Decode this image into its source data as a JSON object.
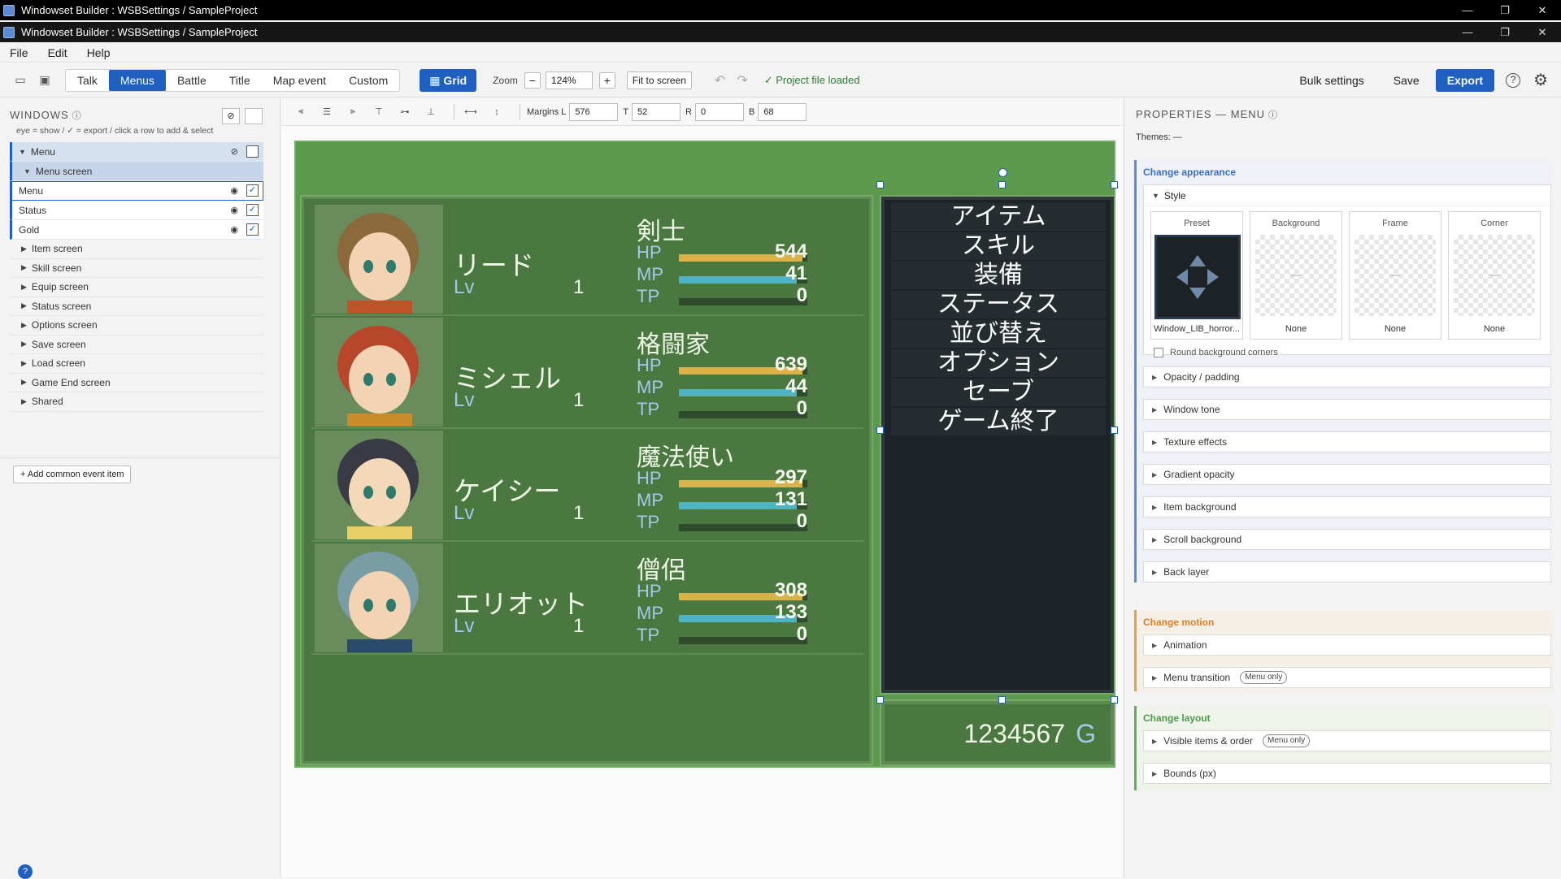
{
  "window_title": "Windowset Builder : WSBSettings / SampleProject",
  "window_controls": [
    "—",
    "❐",
    "✕"
  ],
  "menubar": [
    "File",
    "Edit",
    "Help"
  ],
  "toolbar": {
    "tabs": [
      "Talk",
      "Menus",
      "Battle",
      "Title",
      "Map event",
      "Custom"
    ],
    "active_tab": "Menus",
    "grid_label": "Grid",
    "zoom_label": "Zoom",
    "zoom_value": "124%",
    "fit_label": "Fit to screen",
    "status": "✓ Project file loaded",
    "bulk_label": "Bulk settings",
    "save_label": "Save",
    "export_label": "Export"
  },
  "left": {
    "title": "WINDOWS",
    "hint": "eye = show / ✓ = export / click a row to add & select",
    "menu_label": "Menu",
    "screen_label": "Menu screen",
    "items": [
      "Menu",
      "Status",
      "Gold"
    ],
    "screens": [
      "Item screen",
      "Skill screen",
      "Equip screen",
      "Status screen",
      "Options screen",
      "Save screen",
      "Load screen",
      "Game End screen",
      "Shared"
    ],
    "add_label": "+ Add common event item"
  },
  "align": {
    "margins_label": "Margins",
    "L": "576",
    "T": "52",
    "R": "0",
    "B": "68"
  },
  "game": {
    "actors": [
      {
        "name": "リード",
        "class": "剣士",
        "lv_label": "Lv",
        "lv": "1",
        "hp": "544",
        "mp": "41",
        "tp": "0",
        "hp_frac": 0.96,
        "mp_frac": 0.92,
        "tp_frac": 0
      },
      {
        "name": "ミシェル",
        "class": "格闘家",
        "lv_label": "Lv",
        "lv": "1",
        "hp": "639",
        "mp": "44",
        "tp": "0",
        "hp_frac": 0.96,
        "mp_frac": 0.92,
        "tp_frac": 0
      },
      {
        "name": "ケイシー",
        "class": "魔法使い",
        "lv_label": "Lv",
        "lv": "1",
        "hp": "297",
        "mp": "131",
        "tp": "0",
        "hp_frac": 0.96,
        "mp_frac": 0.92,
        "tp_frac": 0
      },
      {
        "name": "エリオット",
        "class": "僧侶",
        "lv_label": "Lv",
        "lv": "1",
        "hp": "308",
        "mp": "133",
        "tp": "0",
        "hp_frac": 0.96,
        "mp_frac": 0.92,
        "tp_frac": 0
      }
    ],
    "gauge_labels": {
      "hp": "HP",
      "mp": "MP",
      "tp": "TP"
    },
    "commands": [
      "アイテム",
      "スキル",
      "装備",
      "ステータス",
      "並び替え",
      "オプション",
      "セーブ",
      "ゲーム終了"
    ],
    "gold": "1234567",
    "gold_unit": "G",
    "colors": {
      "hp": "#d9b24a",
      "mp": "#4fb3c4",
      "tp": "#3e9a5c"
    }
  },
  "right": {
    "title": "PROPERTIES — MENU",
    "themes": "Themes: —",
    "appearance_label": "Change appearance",
    "style_label": "Style",
    "tiles": [
      {
        "label": "Preset",
        "value": "Window_LIB_horror..."
      },
      {
        "label": "Background",
        "value": "None"
      },
      {
        "label": "Frame",
        "value": "None"
      },
      {
        "label": "Corner",
        "value": "None"
      }
    ],
    "tile_empty": "—",
    "round_label": "Round background corners",
    "appearance_items": [
      "Opacity / padding",
      "Window tone",
      "Texture effects",
      "Gradient opacity",
      "Item background",
      "Scroll background",
      "Back layer"
    ],
    "motion_label": "Change motion",
    "motion_items": [
      "Animation",
      "Menu transition"
    ],
    "menu_only": "Menu only",
    "layout_label": "Change layout",
    "layout_items": [
      "Visible items & order",
      "Bounds (px)"
    ]
  }
}
